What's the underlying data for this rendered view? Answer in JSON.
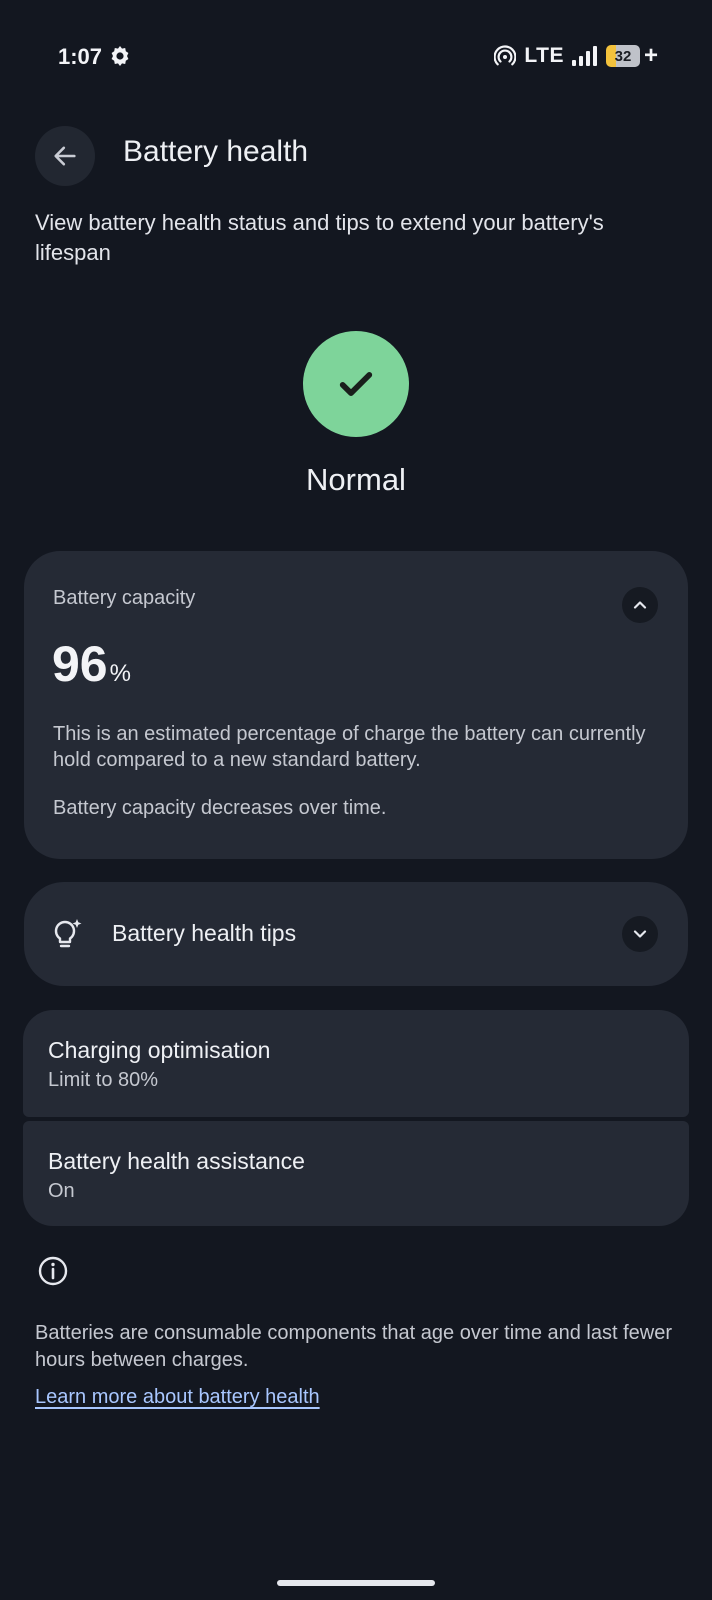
{
  "status_bar": {
    "time": "1:07",
    "network": "LTE",
    "battery_level": "32",
    "battery_charging": "+"
  },
  "header": {
    "title": "Battery health",
    "subtitle": "View battery health status and tips to extend your battery's lifespan"
  },
  "health_status": {
    "label": "Normal",
    "color": "#7ed49a"
  },
  "capacity_card": {
    "label": "Battery capacity",
    "value": "96",
    "unit": "%",
    "description": "This is an estimated percentage of charge the battery can currently hold compared to a new standard battery.",
    "note": "Battery capacity decreases over time."
  },
  "tips_card": {
    "label": "Battery health tips"
  },
  "settings": [
    {
      "title": "Charging optimisation",
      "subtitle": "Limit to 80%"
    },
    {
      "title": "Battery health assistance",
      "subtitle": "On"
    }
  ],
  "footer": {
    "text": "Batteries are consumable components that age over time and last fewer hours between charges.",
    "link": "Learn more about battery health",
    "link_color": "#a9c7ff"
  },
  "icons": {
    "back": "arrow-left-icon",
    "check": "check-icon",
    "collapse": "chevron-up-icon",
    "expand": "chevron-down-icon",
    "tips": "lightbulb-sparkle-icon",
    "info": "info-icon"
  }
}
